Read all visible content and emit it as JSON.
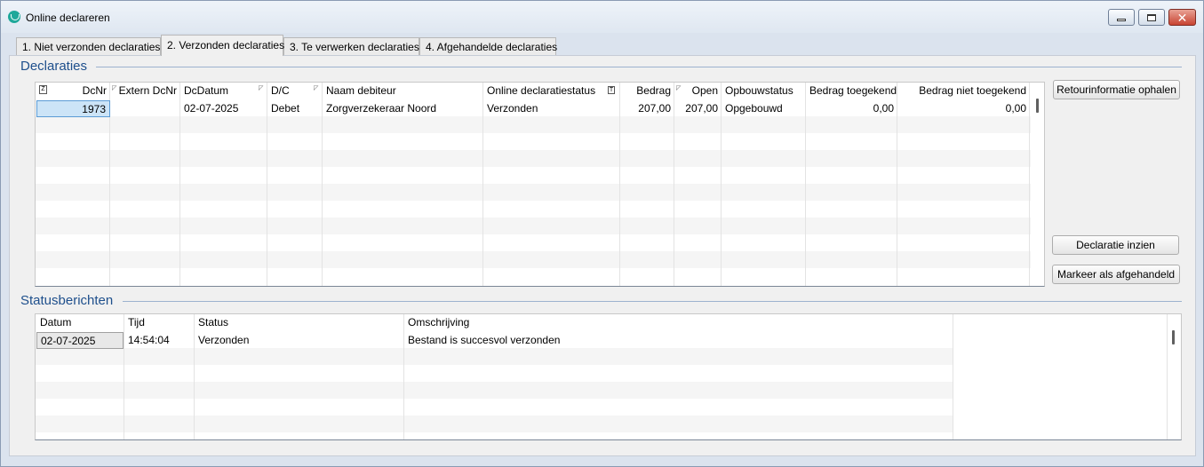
{
  "window": {
    "title": "Online declareren"
  },
  "tabs": [
    {
      "label": "1. Niet verzonden declaraties"
    },
    {
      "label": "2. Verzonden declaraties"
    },
    {
      "label": "3. Te verwerken declaraties"
    },
    {
      "label": "4. Afgehandelde declaraties"
    }
  ],
  "declaraties": {
    "section_title": "Declaraties",
    "columns": [
      "DcNr",
      "Extern DcNr",
      "DcDatum",
      "D/C",
      "Naam debiteur",
      "Online declaratiestatus",
      "Bedrag",
      "Open",
      "Opbouwstatus",
      "Bedrag toegekend",
      "Bedrag niet toegekend"
    ],
    "rows": [
      {
        "dcnr": "1973",
        "extern_dcnr": "",
        "dcdatum": "02-07-2025",
        "dc": "Debet",
        "naam_debiteur": "Zorgverzekeraar Noord",
        "status": "Verzonden",
        "bedrag": "207,00",
        "open": "207,00",
        "opbouwstatus": "Opgebouwd",
        "toegekend": "0,00",
        "niet_toegekend": "0,00"
      }
    ]
  },
  "buttons": {
    "retour": "Retourinformatie ophalen",
    "inzien": "Declaratie inzien",
    "markeer": "Markeer als afgehandeld"
  },
  "statusberichten": {
    "section_title": "Statusberichten",
    "columns": [
      "Datum",
      "Tijd",
      "Status",
      "Omschrijving"
    ],
    "rows": [
      {
        "datum": "02-07-2025",
        "tijd": "14:54:04",
        "status": "Verzonden",
        "omschrijving": "Bestand is succesvol verzonden"
      }
    ]
  }
}
